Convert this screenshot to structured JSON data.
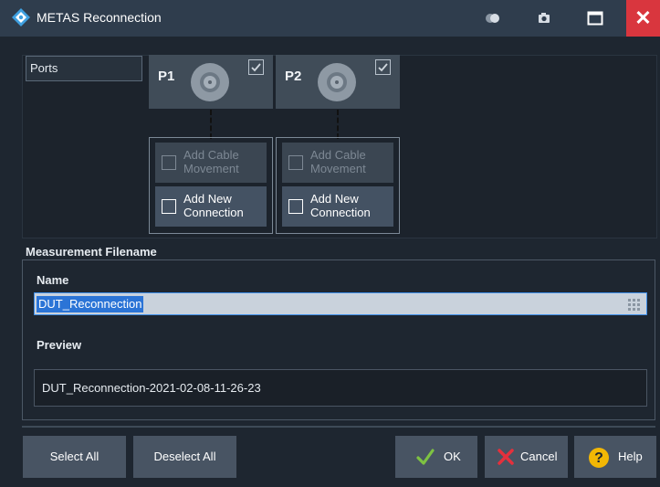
{
  "window": {
    "title": "METAS Reconnection"
  },
  "titlebar_icons": [
    "toggle-icon",
    "camera-icon",
    "maximize-icon",
    "close-icon"
  ],
  "ports": {
    "label": "Ports",
    "items": [
      {
        "name": "P1",
        "checked": true,
        "add_cable_movement": "Add Cable Movement",
        "add_cable_movement_enabled": false,
        "add_new_connection": "Add New Connection",
        "add_new_connection_enabled": true
      },
      {
        "name": "P2",
        "checked": true,
        "add_cable_movement": "Add Cable Movement",
        "add_cable_movement_enabled": false,
        "add_new_connection": "Add New Connection",
        "add_new_connection_enabled": true
      }
    ]
  },
  "measurement": {
    "heading": "Measurement Filename",
    "name_label": "Name",
    "name_value": "DUT_Reconnection",
    "preview_label": "Preview",
    "preview_value": "DUT_Reconnection-2021-02-08-11-26-23"
  },
  "buttons": {
    "select_all": "Select All",
    "deselect_all": "Deselect All",
    "ok": "OK",
    "cancel": "Cancel",
    "help": "Help"
  },
  "colors": {
    "close": "#d9363e",
    "ok_check": "#7ec242",
    "cancel_x": "#e5303c",
    "help": "#f2b705",
    "accent": "#2b74d6"
  }
}
